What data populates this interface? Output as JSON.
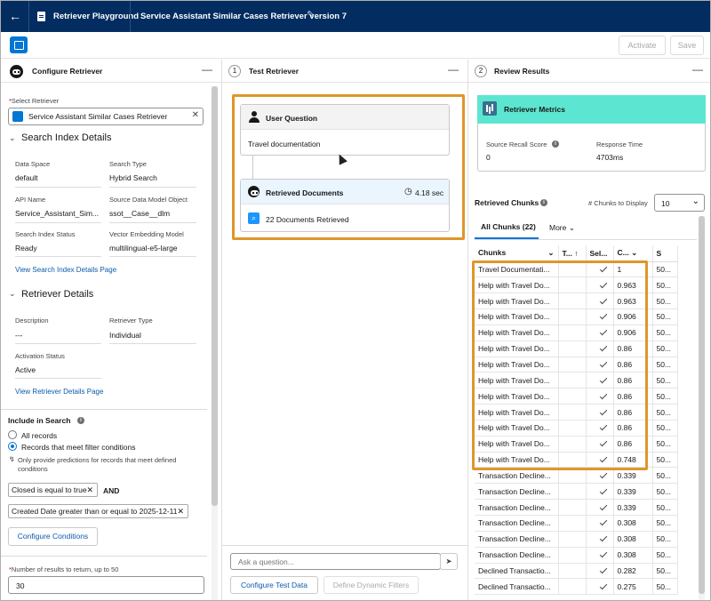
{
  "header": {
    "back_icon": "back-arrow-icon",
    "tab1_label": "Retriever Playground",
    "tab2_label": "Service Assistant Similar Cases Retriever version 7"
  },
  "toolbar": {
    "activate_label": "Activate",
    "save_label": "Save"
  },
  "left_panel": {
    "title": "Configure Retriever",
    "select_label": "Select Retriever",
    "select_value": "Service Assistant Similar Cases Retriever",
    "search_index_section": "Search Index Details",
    "fields": [
      {
        "label": "Data Space",
        "value": "default"
      },
      {
        "label": "Search Type",
        "value": "Hybrid Search"
      },
      {
        "label": "API Name",
        "value": "Service_Assistant_Sim..."
      },
      {
        "label": "Source Data Model Object",
        "value": "ssot__Case__dlm"
      },
      {
        "label": "Search Index Status",
        "value": "Ready"
      },
      {
        "label": "Vector Embedding Model",
        "value": "multilingual-e5-large"
      }
    ],
    "view_index_link": "View Search Index Details Page",
    "retriever_section": "Retriever Details",
    "retriever_fields": [
      {
        "label": "Description",
        "value": "---"
      },
      {
        "label": "Retriever Type",
        "value": "Individual"
      },
      {
        "label": "Activation Status",
        "value": "Active"
      }
    ],
    "view_retriever_link": "View Retriever Details Page",
    "include_label": "Include in Search",
    "option_all": "All records",
    "option_filter": "Records that meet filter conditions",
    "hint": "Only provide predictions for records that meet defined conditions",
    "filter1": "Closed is equal to true",
    "and_label": "AND",
    "filter2": "Created Date greater than or equal to 2025-12-11",
    "configure_conditions": "Configure Conditions",
    "num_results_label": "Number of results to return, up to 50",
    "num_results_value": "30"
  },
  "middle_panel": {
    "step": "1",
    "title": "Test Retriever",
    "user_question_title": "User Question",
    "user_question_text": "Travel documentation",
    "retrieved_title": "Retrieved Documents",
    "retrieved_time": "4.18 sec",
    "retrieved_count": "22 Documents Retrieved",
    "ask_placeholder": "Ask a question...",
    "configure_test_data": "Configure Test Data",
    "define_filters": "Define Dynamic Filters"
  },
  "right_panel": {
    "step": "2",
    "title": "Review Results",
    "metrics_title": "Retriever Metrics",
    "recall_label": "Source Recall Score",
    "recall_value": "0",
    "response_label": "Response Time",
    "response_value": "4703ms",
    "chunks_label": "Retrieved Chunks",
    "chunks_display_label": "# Chunks to Display",
    "chunks_display_value": "10",
    "tab_all": "All Chunks (22)",
    "tab_more": "More",
    "columns": [
      "Chunks",
      "T...",
      "Sel...",
      "C...",
      "S"
    ],
    "rows": [
      {
        "chunk": "Travel Documentati...",
        "score": "1",
        "s": "50..."
      },
      {
        "chunk": "Help with Travel Do...",
        "score": "0.963",
        "s": "50..."
      },
      {
        "chunk": "Help with Travel Do...",
        "score": "0.963",
        "s": "50..."
      },
      {
        "chunk": "Help with Travel Do...",
        "score": "0.906",
        "s": "50..."
      },
      {
        "chunk": "Help with Travel Do...",
        "score": "0.906",
        "s": "50..."
      },
      {
        "chunk": "Help with Travel Do...",
        "score": "0.86",
        "s": "50..."
      },
      {
        "chunk": "Help with Travel Do...",
        "score": "0.86",
        "s": "50..."
      },
      {
        "chunk": "Help with Travel Do...",
        "score": "0.86",
        "s": "50..."
      },
      {
        "chunk": "Help with Travel Do...",
        "score": "0.86",
        "s": "50..."
      },
      {
        "chunk": "Help with Travel Do...",
        "score": "0.86",
        "s": "50..."
      },
      {
        "chunk": "Help with Travel Do...",
        "score": "0.86",
        "s": "50..."
      },
      {
        "chunk": "Help with Travel Do...",
        "score": "0.86",
        "s": "50..."
      },
      {
        "chunk": "Help with Travel Do...",
        "score": "0.748",
        "s": "50..."
      },
      {
        "chunk": "Transaction Decline...",
        "score": "0.339",
        "s": "50..."
      },
      {
        "chunk": "Transaction Decline...",
        "score": "0.339",
        "s": "50..."
      },
      {
        "chunk": "Transaction Decline...",
        "score": "0.339",
        "s": "50..."
      },
      {
        "chunk": "Transaction Decline...",
        "score": "0.308",
        "s": "50..."
      },
      {
        "chunk": "Transaction Decline...",
        "score": "0.308",
        "s": "50..."
      },
      {
        "chunk": "Transaction Decline...",
        "score": "0.308",
        "s": "50..."
      },
      {
        "chunk": "Declined Transactio...",
        "score": "0.282",
        "s": "50..."
      },
      {
        "chunk": "Declined Transactio...",
        "score": "0.275",
        "s": "50..."
      }
    ]
  },
  "colors": {
    "header_bg": "#032d60",
    "brand": "#0176d3",
    "highlight": "#e0962a",
    "metric_bg": "#5ce6d1"
  }
}
